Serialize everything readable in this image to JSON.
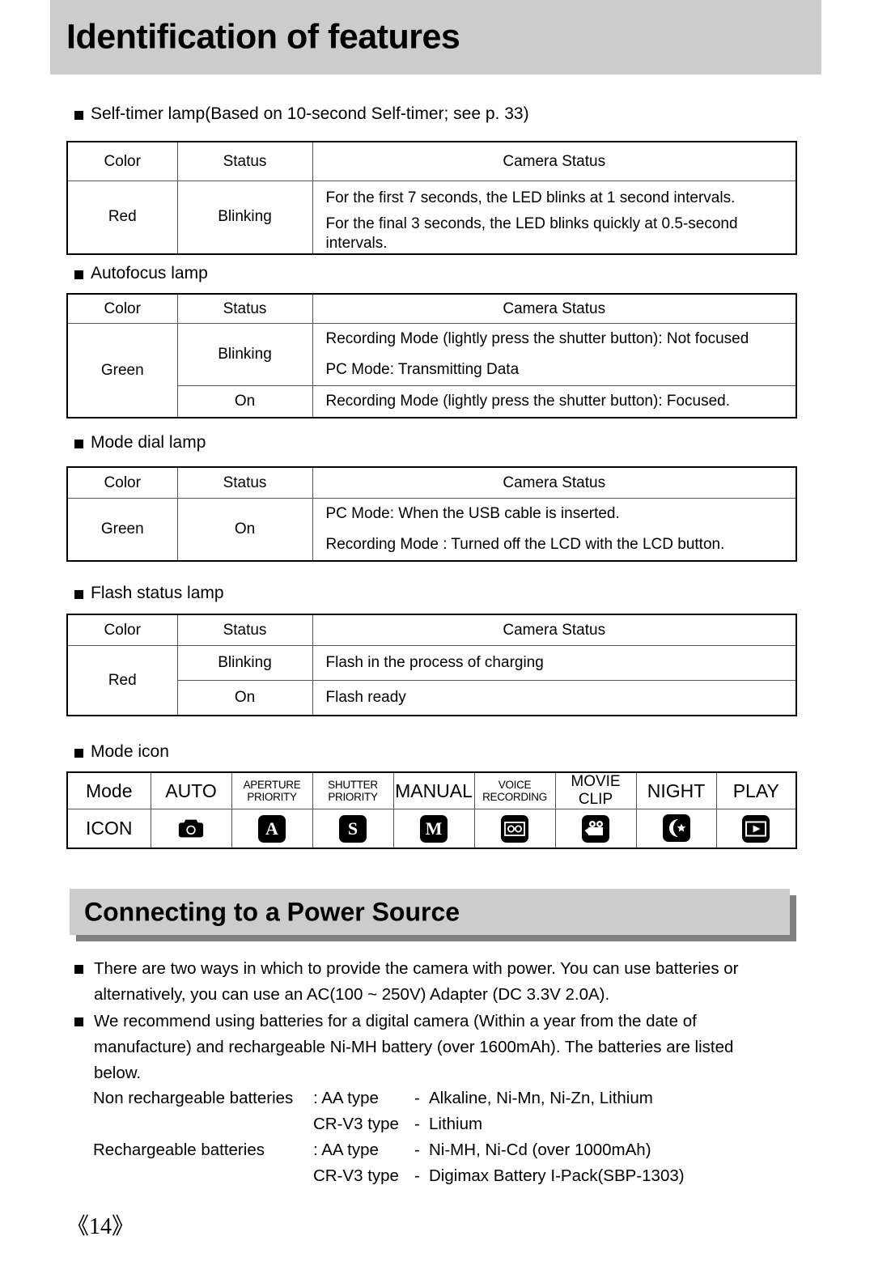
{
  "header": {
    "title": "Identification of features"
  },
  "sections": {
    "self_timer": {
      "label": "Self-timer lamp(Based on 10-second Self-timer; see p. 33)",
      "headers": [
        "Color",
        "Status",
        "Camera Status"
      ],
      "color": "Red",
      "status": "Blinking",
      "lines": [
        "For the first 7 seconds, the LED blinks at 1 second intervals.",
        "For the final 3 seconds, the LED blinks quickly at 0.5-second intervals."
      ]
    },
    "autofocus": {
      "label": "Autofocus lamp",
      "headers": [
        "Color",
        "Status",
        "Camera Status"
      ],
      "color": "Green",
      "status_blinking": "Blinking",
      "status_on": "On",
      "blinking_lines": [
        "Recording Mode (lightly press the shutter button): Not focused",
        "PC Mode: Transmitting Data"
      ],
      "on_line": "Recording Mode (lightly press the shutter button): Focused."
    },
    "mode_dial": {
      "label": "Mode dial lamp",
      "headers": [
        "Color",
        "Status",
        "Camera Status"
      ],
      "color": "Green",
      "status": "On",
      "lines": [
        "PC Mode: When the USB cable is inserted.",
        "Recording Mode : Turned off the LCD with the LCD button."
      ]
    },
    "flash_status": {
      "label": "Flash status lamp",
      "headers": [
        "Color",
        "Status",
        "Camera Status"
      ],
      "color": "Red",
      "status_blinking": "Blinking",
      "status_on": "On",
      "blinking_line": "Flash in the process of charging",
      "on_line": "Flash ready"
    },
    "mode_icon": {
      "label": "Mode icon",
      "row_labels": [
        "Mode",
        "ICON"
      ],
      "modes": [
        {
          "name": "AUTO",
          "small": false,
          "icon": "camera-icon",
          "glyph": ""
        },
        {
          "name": "APERTURE PRIORITY",
          "small": true,
          "icon": "letter-a-icon",
          "glyph": "A"
        },
        {
          "name": "SHUTTER PRIORITY",
          "small": true,
          "icon": "letter-s-icon",
          "glyph": "S"
        },
        {
          "name": "MANUAL",
          "small": false,
          "icon": "letter-m-icon",
          "glyph": "M"
        },
        {
          "name": "VOICE RECORDING",
          "small": true,
          "icon": "cassette-icon",
          "glyph": ""
        },
        {
          "name": "MOVIE CLIP",
          "small": false,
          "icon": "movie-camera-icon",
          "glyph": ""
        },
        {
          "name": "NIGHT",
          "small": false,
          "icon": "moon-star-icon",
          "glyph": ""
        },
        {
          "name": "PLAY",
          "small": false,
          "icon": "play-triangle-icon",
          "glyph": ""
        }
      ]
    }
  },
  "power": {
    "heading": "Connecting to a Power Source",
    "paragraphs": [
      "There are two ways in which to provide the camera with power. You can use batteries or alternatively, you can use an AC(100 ~ 250V) Adapter (DC 3.3V 2.0A).",
      "We recommend using batteries for a digital camera (Within a year from the date of manufacture) and rechargeable Ni-MH battery (over 1600mAh). The batteries are listed below."
    ],
    "battery_rows": [
      {
        "label": "Non rechargeable batteries",
        "type": ": AA type",
        "dash": "-",
        "value": "Alkaline, Ni-Mn, Ni-Zn, Lithium"
      },
      {
        "label": "",
        "type": "CR-V3 type",
        "dash": "-",
        "value": "Lithium"
      },
      {
        "label": "Rechargeable batteries",
        "type": ": AA type",
        "dash": "-",
        "value": "Ni-MH, Ni-Cd (over 1000mAh)"
      },
      {
        "label": "",
        "type": "CR-V3 type",
        "dash": "-",
        "value": "Digimax Battery I-Pack(SBP-1303)"
      }
    ]
  },
  "footer": {
    "page_number": "《14》"
  },
  "colors": {
    "header_band": "#cccccc",
    "heading_shadow": "#808080",
    "rule": "#555555",
    "outer_rule": "#000000"
  }
}
